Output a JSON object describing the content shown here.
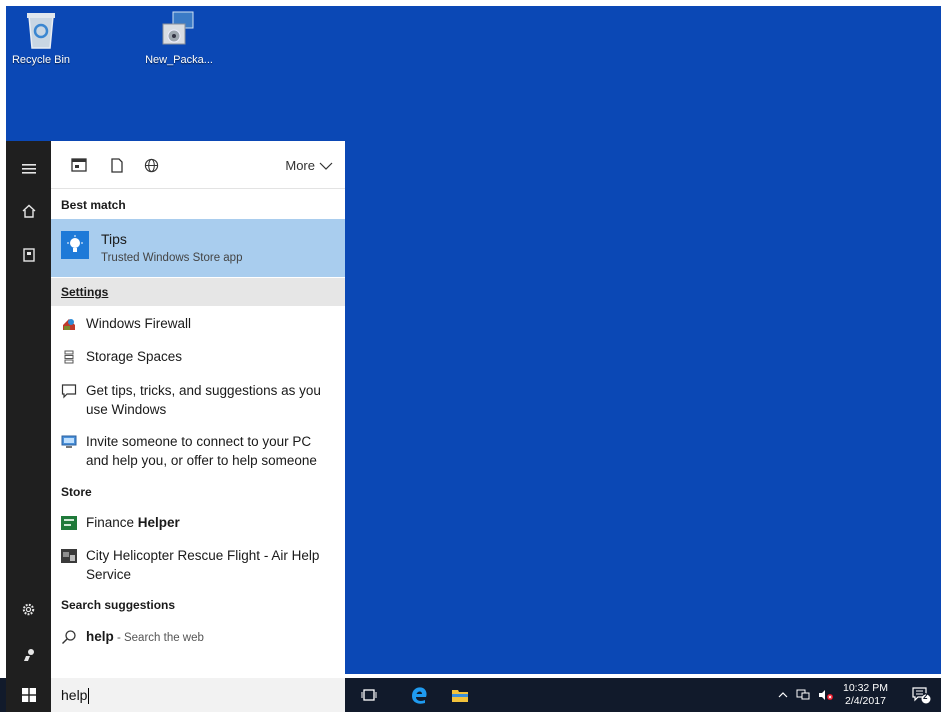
{
  "desktop": {
    "icons": [
      {
        "label": "Recycle Bin",
        "icon": "recycle-bin-icon"
      },
      {
        "label": "New_Packa...",
        "icon": "installer-package-icon"
      }
    ]
  },
  "start_rail": {
    "items": [
      "hamburger-menu-icon",
      "home-icon",
      "notebook-icon",
      "settings-gear-icon",
      "feedback-icon"
    ]
  },
  "search_panel": {
    "filters": [
      "apps-filter-icon",
      "documents-filter-icon",
      "web-filter-icon"
    ],
    "more_label": "More",
    "best_match_heading": "Best match",
    "best_match": {
      "title": "Tips",
      "subtitle": "Trusted Windows Store app",
      "icon": "lightbulb-icon"
    },
    "settings_heading": "Settings",
    "settings_items": [
      {
        "label": "Windows Firewall",
        "icon": "firewall-icon"
      },
      {
        "label": "Storage Spaces",
        "icon": "storage-spaces-icon"
      },
      {
        "label": "Get tips, tricks, and suggestions as you use Windows",
        "icon": "chat-bubble-icon"
      },
      {
        "label": "Invite someone to connect to your PC and help you, or offer to help someone",
        "icon": "remote-assistance-icon"
      }
    ],
    "store_heading": "Store",
    "store_items": [
      {
        "label_prefix": "Finance ",
        "label_bold": "Helper",
        "icon": "finance-app-icon"
      },
      {
        "label": "City Helicopter Rescue Flight - Air Help Service",
        "icon": "game-app-icon"
      }
    ],
    "suggestions_heading": "Search suggestions",
    "suggestion": {
      "query": "help",
      "suffix": " - Search the web",
      "icon": "search-icon"
    },
    "query": "help"
  },
  "taskbar": {
    "apps": [
      "task-view-icon",
      "edge-icon",
      "file-explorer-icon"
    ],
    "tray": [
      "show-hidden-icons-icon",
      "network-icon",
      "volume-muted-icon"
    ],
    "time": "10:32 PM",
    "date": "2/4/2017",
    "notification_count": "2"
  },
  "colors": {
    "desktop": "#0b48b5",
    "best_match_bg": "#a9cdee",
    "taskbar": "#111a2b"
  }
}
